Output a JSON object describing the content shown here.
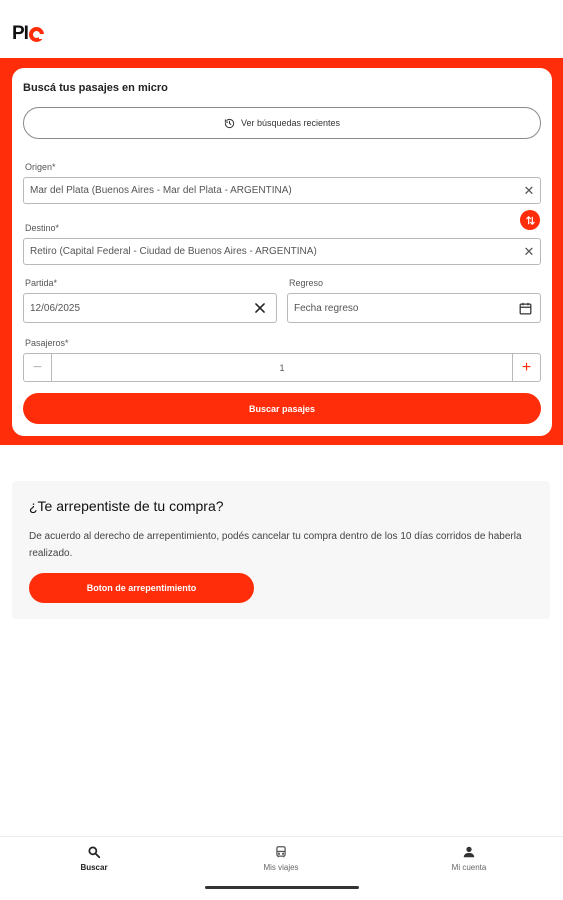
{
  "header": {
    "logo_text": "PI",
    "brand_color": "#ff2d0a"
  },
  "search_card": {
    "title": "Buscá tus pasajes en micro",
    "recent_searches_label": "Ver búsquedas recientes",
    "recent_icon": "history-icon",
    "origin": {
      "label": "Origen*",
      "value": "Mar del Plata (Buenos Aires - Mar del Plata - ARGENTINA)"
    },
    "destination": {
      "label": "Destino*",
      "value": "Retiro (Capital Federal - Ciudad de Buenos Aires - ARGENTINA)"
    },
    "swap_icon": "swap-vertical-icon",
    "departure": {
      "label": "Partida*",
      "value": "12/06/2025"
    },
    "return": {
      "label": "Regreso",
      "placeholder": "Fecha regreso"
    },
    "passengers": {
      "label": "Pasajeros*",
      "value": "1",
      "minus": "−",
      "plus": "+"
    },
    "search_button": "Buscar pasajes"
  },
  "refund": {
    "title": "¿Te arrepentiste de tu compra?",
    "text": "De acuerdo al derecho de arrepentimiento, podés cancelar tu compra dentro de los 10 días corridos de haberla realizado.",
    "button": "Boton de arrepentimiento"
  },
  "bottom_nav": {
    "items": [
      {
        "label": "Buscar",
        "icon": "search-icon",
        "active": true
      },
      {
        "label": "Mis viajes",
        "icon": "bus-icon",
        "active": false
      },
      {
        "label": "Mi cuenta",
        "icon": "person-icon",
        "active": false
      }
    ]
  }
}
